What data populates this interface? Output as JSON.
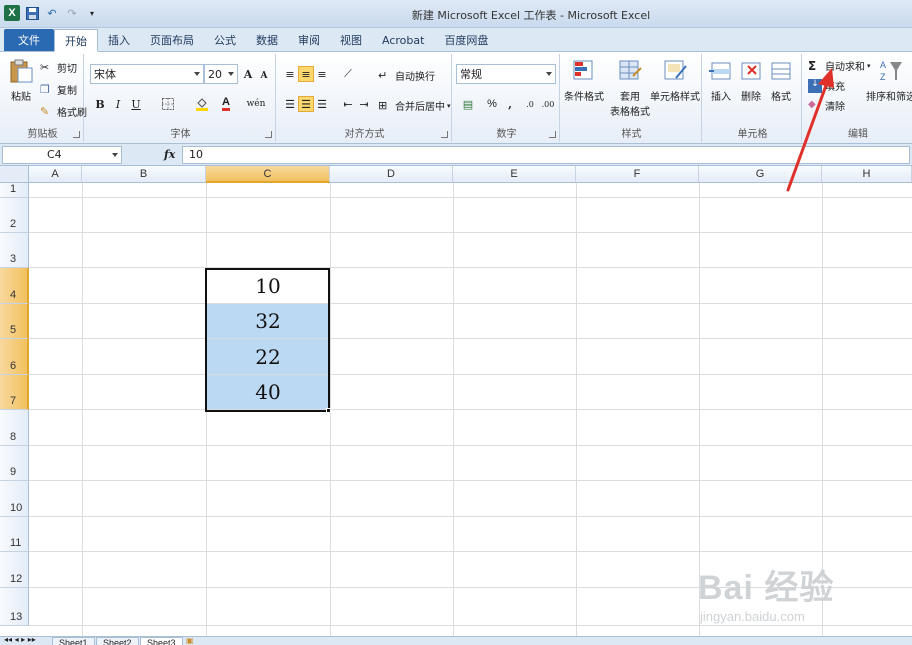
{
  "window": {
    "title": "新建 Microsoft Excel 工作表 - Microsoft Excel"
  },
  "tabs": [
    {
      "label": "文件"
    },
    {
      "label": "开始"
    },
    {
      "label": "插入"
    },
    {
      "label": "页面布局"
    },
    {
      "label": "公式"
    },
    {
      "label": "数据"
    },
    {
      "label": "审阅"
    },
    {
      "label": "视图"
    },
    {
      "label": "Acrobat"
    },
    {
      "label": "百度网盘"
    }
  ],
  "ribbon": {
    "clipboard": {
      "paste": "粘贴",
      "cut": "剪切",
      "copy": "复制",
      "format_painter": "格式刷",
      "label": "剪贴板"
    },
    "font": {
      "name": "宋体",
      "size": "20",
      "bold": "B",
      "italic": "I",
      "underline": "U",
      "grow": "A",
      "shrink": "A",
      "wen": "wén",
      "label": "字体"
    },
    "alignment": {
      "wrap": "自动换行",
      "merge": "合并后居中",
      "label": "对齐方式"
    },
    "number": {
      "format": "常规",
      "percent": "%",
      "comma": ",",
      "label": "数字"
    },
    "styles": {
      "conditional": "条件格式",
      "table_l1": "套用",
      "table_l2": "表格格式",
      "cell_styles": "单元格样式",
      "label": "样式"
    },
    "cells": {
      "insert": "插入",
      "delete": "删除",
      "format": "格式",
      "label": "单元格"
    },
    "editing": {
      "autosum": "自动求和",
      "fill": "填充",
      "clear": "清除",
      "sort": "排序和筛选",
      "label": "编辑"
    }
  },
  "formula_bar": {
    "name_box": "C4",
    "fx": "fx",
    "value": "10"
  },
  "columns": [
    "A",
    "B",
    "C",
    "D",
    "E",
    "F",
    "G",
    "H"
  ],
  "rows": [
    "1",
    "2",
    "3",
    "4",
    "5",
    "6",
    "7",
    "8",
    "9",
    "10",
    "11",
    "12",
    "13"
  ],
  "cells": {
    "C4": "10",
    "C5": "32",
    "C6": "22",
    "C7": "40"
  },
  "sheets": [
    "Sheet1",
    "Sheet2",
    "Sheet3"
  ],
  "watermark": {
    "brand": "Bai 经验",
    "url": "jingyan.baidu.com"
  },
  "colors": {
    "accent": "#2a6ab3",
    "selection": "#bcd9f3",
    "header_selected": "#f1c15f",
    "annotation": "#e0302a"
  }
}
